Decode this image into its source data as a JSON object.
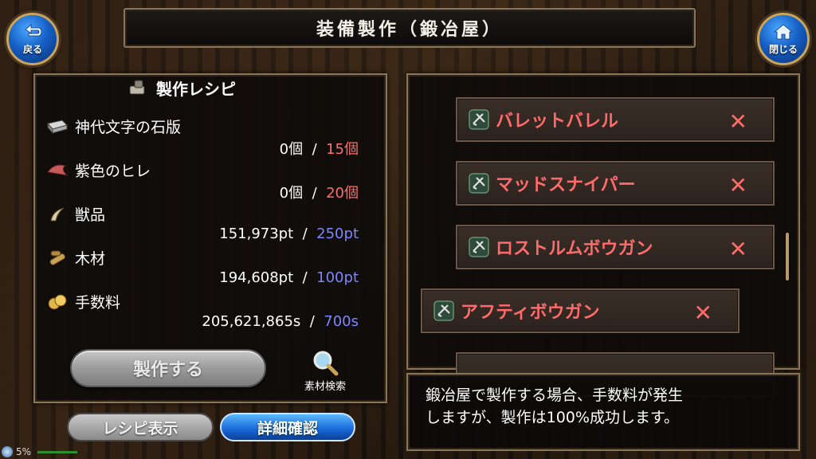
{
  "header": {
    "title": "装備製作（鍛冶屋）"
  },
  "nav": {
    "back_label": "戻る",
    "close_label": "閉じる"
  },
  "recipe": {
    "title": "製作レシピ",
    "materials": [
      {
        "name": "神代文字の石版",
        "owned": "0個",
        "sep": "/",
        "required": "15個",
        "required_color": "red",
        "icon": "stone-tablet-icon"
      },
      {
        "name": "紫色のヒレ",
        "owned": "0個",
        "sep": "/",
        "required": "20個",
        "required_color": "red",
        "icon": "fin-icon"
      },
      {
        "name": "獣品",
        "owned": "151,973pt",
        "sep": "/",
        "required": "250pt",
        "required_color": "blue",
        "icon": "fang-icon"
      },
      {
        "name": "木材",
        "owned": "194,608pt",
        "sep": "/",
        "required": "100pt",
        "required_color": "blue",
        "icon": "wood-icon"
      },
      {
        "name": "手数料",
        "owned": "205,621,865s",
        "sep": "/",
        "required": "700s",
        "required_color": "blue",
        "icon": "coin-icon"
      }
    ],
    "make_button": "製作する",
    "search_label": "素材検索"
  },
  "bottom_buttons": {
    "recipe_view": "レシピ表示",
    "detail_check": "詳細確認"
  },
  "weapon_list": [
    {
      "name": "バレットバレル",
      "mark": "✕",
      "icon": "crossbow-icon"
    },
    {
      "name": "マッドスナイパー",
      "mark": "✕",
      "icon": "crossbow-icon"
    },
    {
      "name": "ロストルムボウガン",
      "mark": "✕",
      "icon": "crossbow-icon"
    },
    {
      "name": "アフティボウガン",
      "mark": "✕",
      "icon": "crossbow-icon",
      "selected": true
    }
  ],
  "info": {
    "line1": "鍛冶屋で製作する場合、手数料が発生",
    "line2": "しますが、製作は100%成功します。"
  },
  "status": {
    "battery": "5%"
  },
  "colors": {
    "required_red": "#ff6f6a",
    "required_blue": "#7d86ff",
    "weapon_name": "#ff6b6b",
    "frame_gold": "#8c7556"
  }
}
